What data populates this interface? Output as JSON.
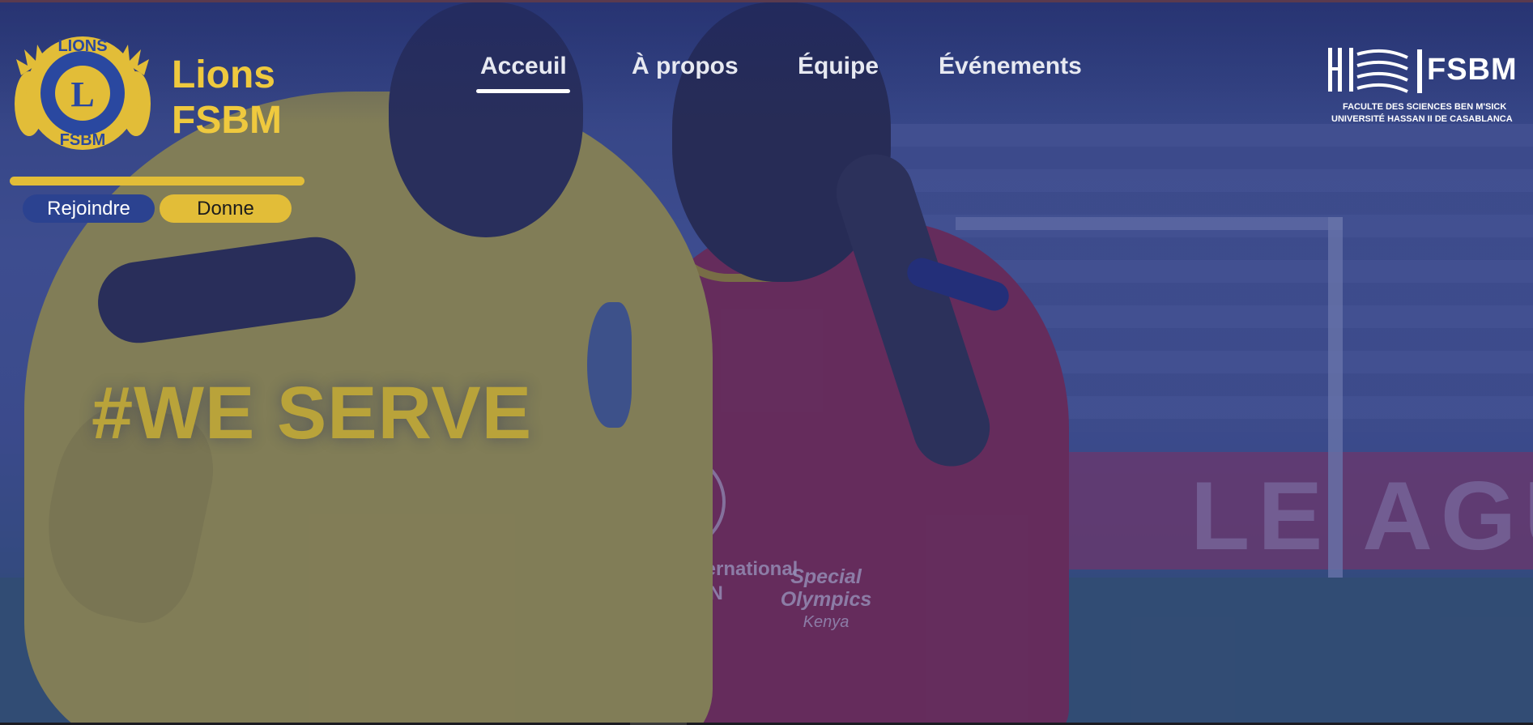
{
  "brand": {
    "title_line1": "Lions",
    "title_line2": "FSBM"
  },
  "lions_logo": {
    "top_text": "LIONS",
    "bottom_text": "FSBM",
    "letter": "L"
  },
  "buttons": {
    "join_label": "Rejoindre",
    "give_label": "Donne"
  },
  "nav": {
    "items": [
      {
        "label": "Acceuil",
        "active": true
      },
      {
        "label": "À propos",
        "active": false
      },
      {
        "label": "Équipe",
        "active": false
      },
      {
        "label": "Événements",
        "active": false
      }
    ]
  },
  "faculty_logo": {
    "short_name": "FSBM",
    "line1": "FACULTE DES SCIENCES BEN M'SICK",
    "line2": "UNIVERSITÉ HASSAN II DE CASABLANCA"
  },
  "hero": {
    "slogan": "#WE SERVE",
    "shirt_text_line1": "Clubs International",
    "shirt_text_line2": "UNDATION",
    "shirt_text_so_1": "Special",
    "shirt_text_so_2": "Olympics",
    "shirt_text_so_3": "Kenya",
    "banner_text": "LE AGUE",
    "image_description_icon": "photo-background"
  },
  "colors": {
    "accent_yellow": "#e2bd38",
    "brand_blue": "#2b4290",
    "overlay_blue": "#202e78"
  }
}
